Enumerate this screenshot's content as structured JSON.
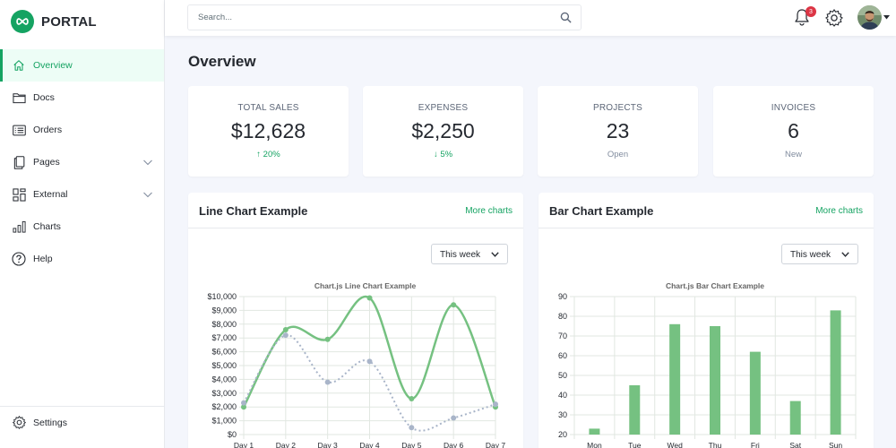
{
  "brand": {
    "name": "PORTAL",
    "icon": "infinity-icon",
    "color": "#15a362"
  },
  "sidebar": {
    "items": [
      {
        "label": "Overview",
        "icon": "home-icon",
        "active": true
      },
      {
        "label": "Docs",
        "icon": "folder-icon"
      },
      {
        "label": "Orders",
        "icon": "card-list-icon"
      },
      {
        "label": "Pages",
        "icon": "files-icon",
        "expandable": true
      },
      {
        "label": "External",
        "icon": "columns-icon",
        "expandable": true
      },
      {
        "label": "Charts",
        "icon": "bar-chart-icon"
      },
      {
        "label": "Help",
        "icon": "question-circle-icon"
      }
    ],
    "settings": {
      "label": "Settings",
      "icon": "gear-icon"
    }
  },
  "header": {
    "search": {
      "placeholder": "Search...",
      "value": ""
    },
    "notifications": {
      "count": "3",
      "icon": "bell-icon"
    },
    "settings_icon": "gear-icon",
    "avatar_icon": "avatar"
  },
  "page": {
    "title": "Overview"
  },
  "stats": [
    {
      "label": "TOTAL SALES",
      "value": "$12,628",
      "sub": "↑ 20%",
      "sub_color": "#15a362"
    },
    {
      "label": "EXPENSES",
      "value": "$2,250",
      "sub": "↓ 5%",
      "sub_color": "#15a362"
    },
    {
      "label": "PROJECTS",
      "value": "23",
      "sub": "Open"
    },
    {
      "label": "INVOICES",
      "value": "6",
      "sub": "New"
    }
  ],
  "cards": {
    "line": {
      "title": "Line Chart Example",
      "link": "More charts",
      "select": "This week"
    },
    "bar": {
      "title": "Bar Chart Example",
      "link": "More charts",
      "select": "This week"
    }
  },
  "chart_data": [
    {
      "type": "line",
      "title": "Chart.js Line Chart Example",
      "categories": [
        "Day 1",
        "Day 2",
        "Day 3",
        "Day 4",
        "Day 5",
        "Day 6",
        "Day 7"
      ],
      "series": [
        {
          "values": [
            2000,
            7600,
            6900,
            9900,
            2600,
            9400,
            2000
          ],
          "color": "#75c181",
          "style": "solid"
        },
        {
          "values": [
            2300,
            7200,
            3800,
            5300,
            500,
            1200,
            2200
          ],
          "color": "#a9b5c9",
          "style": "dotted"
        }
      ],
      "ylim": [
        0,
        10000
      ],
      "yticks": [
        "$0",
        "$1,000",
        "$2,000",
        "$3,000",
        "$4,000",
        "$5,000",
        "$6,000",
        "$7,000",
        "$8,000",
        "$9,000",
        "$10,000"
      ],
      "grid": true
    },
    {
      "type": "bar",
      "title": "Chart.js Bar Chart Example",
      "categories": [
        "Mon",
        "Tue",
        "Wed",
        "Thu",
        "Fri",
        "Sat",
        "Sun"
      ],
      "values": [
        23,
        45,
        76,
        75,
        62,
        37,
        83
      ],
      "color": "#75c181",
      "ylim": [
        20,
        90
      ],
      "yticks": [
        "20",
        "30",
        "40",
        "50",
        "60",
        "70",
        "80",
        "90"
      ],
      "grid": true
    }
  ]
}
